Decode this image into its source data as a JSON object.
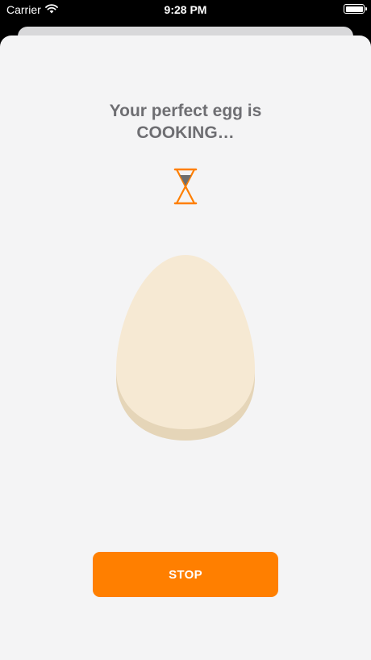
{
  "status_bar": {
    "carrier": "Carrier",
    "time": "9:28 PM",
    "wifi_icon": "wifi-icon",
    "battery_icon": "battery-icon"
  },
  "main": {
    "title_line1": "Your perfect egg is",
    "title_line2": "COOKING…",
    "status_icon": "hourglass-icon",
    "image": "egg-illustration"
  },
  "actions": {
    "stop_label": "STOP"
  },
  "colors": {
    "accent": "#ff7f00",
    "title_text": "#6e6e72",
    "background": "#f4f4f5",
    "egg": "#f6e9d3",
    "egg_shadow": "#e5d5b8"
  }
}
